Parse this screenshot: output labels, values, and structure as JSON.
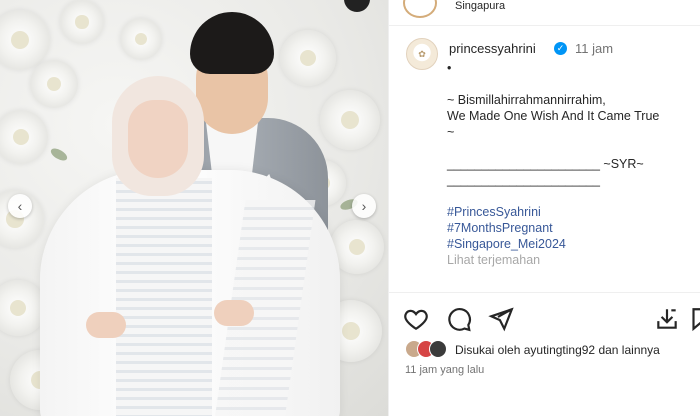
{
  "location": {
    "text": "Singapura"
  },
  "post": {
    "username": "princessyahrini",
    "verified_icon": "verified-badge-icon",
    "time_ago": "11 jam",
    "caption_lines": [
      "•",
      "",
      "~ Bismillahirrahmannirrahim,",
      "We Made One Wish And It Came True",
      "~",
      "",
      "______________________ ~SYR~",
      "______________________",
      "",
      "#PrincesSyahrini",
      "#7MonthsPregnant",
      "#Singapore_Mei2024",
      "Lihat terjemahan"
    ],
    "liked_by_text": "Disukai oleh",
    "liked_by_user": "ayutingting92",
    "liked_by_suffix": "dan lainnya",
    "posted_time": "11 jam yang lalu"
  },
  "actions": {
    "like": "heart-icon",
    "comment": "comment-icon",
    "share": "share-icon",
    "save": "bookmark-icon",
    "download": "download-icon"
  },
  "colors": {
    "link": "#385898",
    "verified": "#0095f6",
    "secondary": "#737373"
  }
}
